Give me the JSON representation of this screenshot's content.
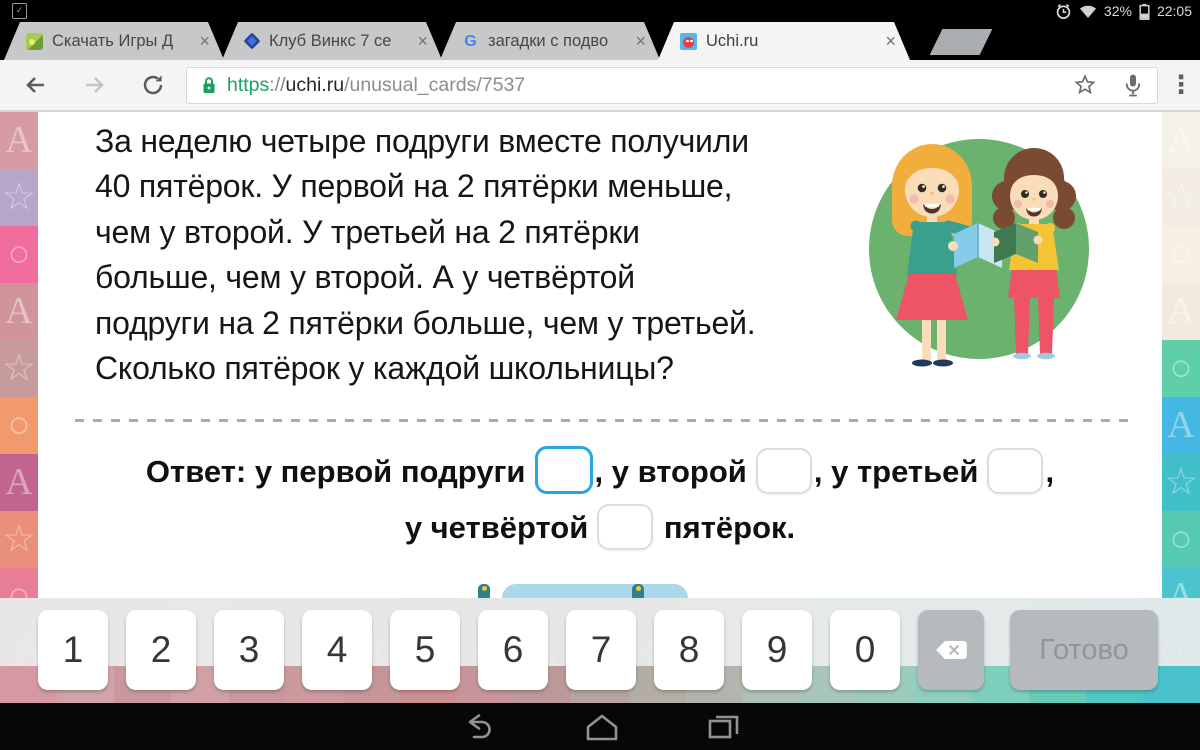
{
  "status_bar": {
    "time": "22:05",
    "battery_percent": "32%",
    "icons": [
      "screenshot-notification-icon",
      "alarm-icon",
      "wifi-icon",
      "battery-icon"
    ]
  },
  "chrome": {
    "close_glyph": "×",
    "menu_glyph": "⋮",
    "tabs": [
      {
        "title": "Скачать Игры Д",
        "favicon": "games-site-favicon",
        "active": false
      },
      {
        "title": "Клуб Винкс 7 се",
        "favicon": "winx-site-favicon",
        "active": false
      },
      {
        "title": "загадки с подво",
        "favicon": "google-favicon",
        "active": false
      },
      {
        "title": "Uchi.ru",
        "favicon": "uchi-favicon",
        "active": true
      }
    ],
    "url": {
      "scheme": "https",
      "separator": "://",
      "host": "uchi.ru",
      "path": "/unusual_cards/7537"
    },
    "toolbar_icons": [
      "back-icon",
      "forward-icon",
      "reload-icon",
      "lock-icon",
      "star-icon",
      "mic-icon",
      "menu-icon"
    ]
  },
  "problem": {
    "text": "За неделю четыре подруги вместе получили\n40 пятёрок. У первой на 2 пятёрки меньше,\nчем у второй. У третьей на 2 пятёрки\nбольше, чем у второй. А у четвёртой\nподруги на 2 пятёрки больше, чем у третьей.\nСколько пятёрок у каждой школьницы?",
    "illustration": "two-schoolgirls-reading-books-on-green-circle"
  },
  "answer": {
    "seg1": "Ответ: у первой подруги",
    "seg2": ", у второй",
    "seg3": ", у третьей",
    "seg4": ",",
    "line2_prefix": "у четвёртой",
    "line2_suffix": "пятёрок.",
    "inputs": [
      "",
      "",
      "",
      ""
    ],
    "focused_input_index": 0,
    "focus_color": "#27a6e5"
  },
  "keyboard": {
    "keys": [
      "1",
      "2",
      "3",
      "4",
      "5",
      "6",
      "7",
      "8",
      "9",
      "0"
    ],
    "backspace": "backspace-icon",
    "done_label": "Готово"
  },
  "nav_bar": {
    "icons": [
      "back-nav-icon",
      "home-nav-icon",
      "recents-nav-icon"
    ]
  },
  "background": {
    "left_tiles": [
      {
        "icon": "letter-a-tile-icon",
        "glyph": "A",
        "color": "#d79ba3"
      },
      {
        "icon": "star-tile-icon",
        "glyph": "☆",
        "color": "#b7a6c9"
      },
      {
        "icon": "globe-tile-icon",
        "glyph": "○",
        "color": "#f06d9d"
      },
      {
        "icon": "letter-a-tile-icon",
        "glyph": "A",
        "color": "#d1949b"
      },
      {
        "icon": "star-tile-icon",
        "glyph": "☆",
        "color": "#c79b9b"
      },
      {
        "icon": "globe-tile-icon",
        "glyph": "○",
        "color": "#f09a6d"
      },
      {
        "icon": "letter-a-tile-icon",
        "glyph": "A",
        "color": "#c26490"
      },
      {
        "icon": "star-tile-icon",
        "glyph": "☆",
        "color": "#ea8f7a"
      },
      {
        "icon": "globe-tile-icon",
        "glyph": "○",
        "color": "#e87e95"
      }
    ],
    "right_tiles": [
      {
        "icon": "letter-a-tile-icon",
        "glyph": "A",
        "color": "#f6f1e8"
      },
      {
        "icon": "star-tile-icon",
        "glyph": "☆",
        "color": "#f2ece2"
      },
      {
        "icon": "globe-tile-icon",
        "glyph": "○",
        "color": "#f6efe4"
      },
      {
        "icon": "letter-a-tile-icon",
        "glyph": "A",
        "color": "#f1eadd"
      },
      {
        "icon": "globe-tile-icon",
        "glyph": "○",
        "color": "#5fcfa8"
      },
      {
        "icon": "letter-a-tile-icon",
        "glyph": "A",
        "color": "#44b8e2"
      },
      {
        "icon": "star-tile-icon",
        "glyph": "☆",
        "color": "#41c0c9"
      },
      {
        "icon": "globe-tile-icon",
        "glyph": "○",
        "color": "#55c9b2"
      },
      {
        "icon": "letter-a-tile-icon",
        "glyph": "A",
        "color": "#4cc3cf"
      }
    ],
    "bottom_tiles": [
      {
        "icon": "letter-a-tile-icon",
        "glyph": "A",
        "color": "#d59aa1"
      },
      {
        "icon": "star-tile-icon",
        "glyph": "☆",
        "color": "#cfa3a8"
      },
      {
        "icon": "globe-tile-icon",
        "glyph": "○",
        "color": "#c9989e"
      },
      {
        "icon": "letter-a-tile-icon",
        "glyph": "A",
        "color": "#d0a0a4"
      },
      {
        "icon": "star-tile-icon",
        "glyph": "☆",
        "color": "#c6989e"
      },
      {
        "icon": "globe-tile-icon",
        "glyph": "○",
        "color": "#cc9a9c"
      },
      {
        "icon": "letter-a-tile-icon",
        "glyph": "A",
        "color": "#c59598"
      },
      {
        "icon": "star-tile-icon",
        "glyph": "☆",
        "color": "#cc8f93"
      },
      {
        "icon": "globe-tile-icon",
        "glyph": "○",
        "color": "#c79599"
      },
      {
        "icon": "letter-a-tile-icon",
        "glyph": "A",
        "color": "#bd9898"
      },
      {
        "icon": "star-tile-icon",
        "glyph": "☆",
        "color": "#b7a39f"
      },
      {
        "icon": "globe-tile-icon",
        "glyph": "○",
        "color": "#b3ada6"
      },
      {
        "icon": "letter-a-tile-icon",
        "glyph": "A",
        "color": "#b2b5ad"
      },
      {
        "icon": "star-tile-icon",
        "glyph": "☆",
        "color": "#aebfb6"
      },
      {
        "icon": "globe-tile-icon",
        "glyph": "○",
        "color": "#a8c5ba"
      },
      {
        "icon": "letter-a-tile-icon",
        "glyph": "A",
        "color": "#9ccabb"
      },
      {
        "icon": "star-tile-icon",
        "glyph": "☆",
        "color": "#8fcfbd"
      },
      {
        "icon": "globe-tile-icon",
        "glyph": "○",
        "color": "#7ed0bd"
      },
      {
        "icon": "letter-a-tile-icon",
        "glyph": "A",
        "color": "#66ccb8"
      },
      {
        "icon": "star-tile-icon",
        "glyph": "☆",
        "color": "#52c6c0"
      },
      {
        "icon": "globe-tile-icon",
        "glyph": "○",
        "color": "#49c2cb"
      }
    ]
  }
}
